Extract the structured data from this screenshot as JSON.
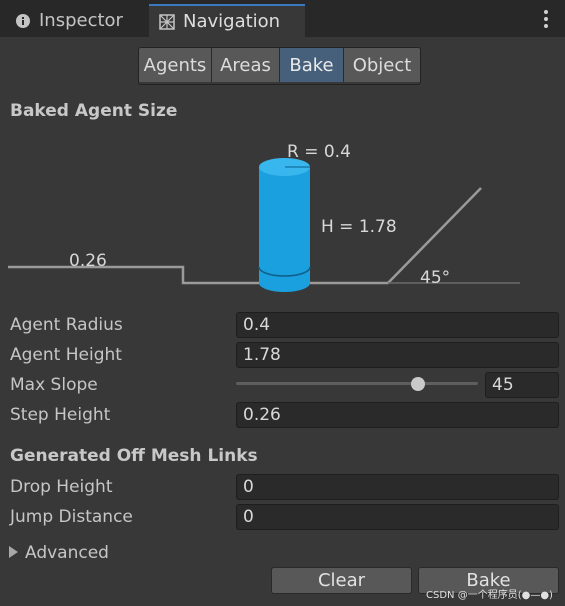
{
  "tabs": {
    "inspector": {
      "label": "Inspector",
      "icon": "info-icon"
    },
    "navigation": {
      "label": "Navigation",
      "icon": "navigation-icon"
    }
  },
  "segment": {
    "options": [
      "Agents",
      "Areas",
      "Bake",
      "Object"
    ],
    "selected": "Bake"
  },
  "baked_agent_size": {
    "title": "Baked Agent Size",
    "diagram": {
      "radius_label": "R = 0.4",
      "height_label": "H = 1.78",
      "step_label": "0.26",
      "slope_label": "45°",
      "cylinder_color": "#1a9fdf"
    }
  },
  "fields": {
    "agent_radius": {
      "label": "Agent Radius",
      "value": "0.4"
    },
    "agent_height": {
      "label": "Agent Height",
      "value": "1.78"
    },
    "max_slope": {
      "label": "Max Slope",
      "value": "45",
      "slider_fraction": 0.75
    },
    "step_height": {
      "label": "Step Height",
      "value": "0.26"
    }
  },
  "off_mesh": {
    "title": "Generated Off Mesh Links",
    "drop_height": {
      "label": "Drop Height",
      "value": "0"
    },
    "jump_distance": {
      "label": "Jump Distance",
      "value": "0"
    }
  },
  "advanced": {
    "label": "Advanced"
  },
  "buttons": {
    "clear": "Clear",
    "bake": "Bake"
  },
  "watermark": "CSDN @一个程序员(●—●)",
  "colors": {
    "accent": "#3a79bb",
    "selected_segment": "#46607c",
    "background": "#383838"
  }
}
